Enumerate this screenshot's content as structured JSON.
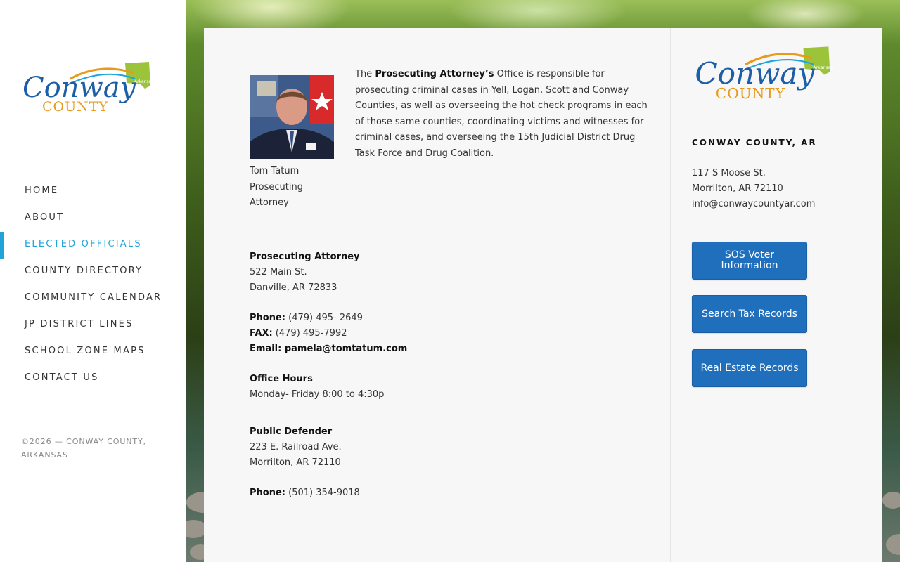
{
  "sidebar": {
    "logo_alt": "Conway County",
    "nav": [
      {
        "label": "HOME",
        "active": false
      },
      {
        "label": "ABOUT",
        "active": false
      },
      {
        "label": "ELECTED OFFICIALS",
        "active": true
      },
      {
        "label": "COUNTY DIRECTORY",
        "active": false
      },
      {
        "label": "COMMUNITY CALENDAR",
        "active": false
      },
      {
        "label": "JP DISTRICT LINES",
        "active": false
      },
      {
        "label": "SCHOOL ZONE MAPS",
        "active": false
      },
      {
        "label": "CONTACT US",
        "active": false
      }
    ],
    "copyright": "©2026 — CONWAY COUNTY, ARKANSAS"
  },
  "content": {
    "photo_caption": "Tom Tatum Prosecuting Attorney",
    "intro": {
      "lead": "The ",
      "strong": "Prosecuting Attorney’s",
      "rest": " Office is responsible for prosecuting criminal cases in Yell, Logan, Scott and Conway Counties, as well as overseeing the hot check programs in each of those same counties, coordinating victims and witnesses for criminal cases, and overseeing the 15th Judicial District Drug Task Force and Drug Coalition."
    },
    "prosecutor": {
      "heading": "Prosecuting Attorney",
      "street": "522 Main St.",
      "city": "Danville, AR 72833",
      "phone_label": "Phone:",
      "phone": " (479) 495- 2649",
      "fax_label": "FAX:",
      "fax": " (479) 495-7992",
      "email_label": "Email:",
      "email": " pamela@tomtatum.com"
    },
    "hours": {
      "heading": "Office Hours",
      "value": "Monday- Friday 8:00 to 4:30p"
    },
    "defender": {
      "heading": "Public Defender",
      "street": "223 E. Railroad Ave.",
      "city": "Morrilton, AR 72110",
      "phone_label": "Phone:",
      "phone": " (501) 354-9018"
    }
  },
  "widget": {
    "title": "CONWAY COUNTY, AR",
    "street": "117 S Moose St.",
    "city": "Morrilton, AR 72110",
    "email": "info@conwaycountyar.com",
    "buttons": {
      "sos": "SOS Voter Information",
      "tax": "Search Tax Records",
      "estate": "Real Estate Records"
    }
  },
  "logo": {
    "script_text": "Conway",
    "block_text": "COUNTY",
    "tag_text": "Arkansas"
  },
  "colors": {
    "accent": "#21a3d9",
    "button": "#1f6fbd",
    "logo_blue": "#1d5ea8",
    "logo_orange": "#e89a1c",
    "logo_green": "#9cc43b"
  }
}
